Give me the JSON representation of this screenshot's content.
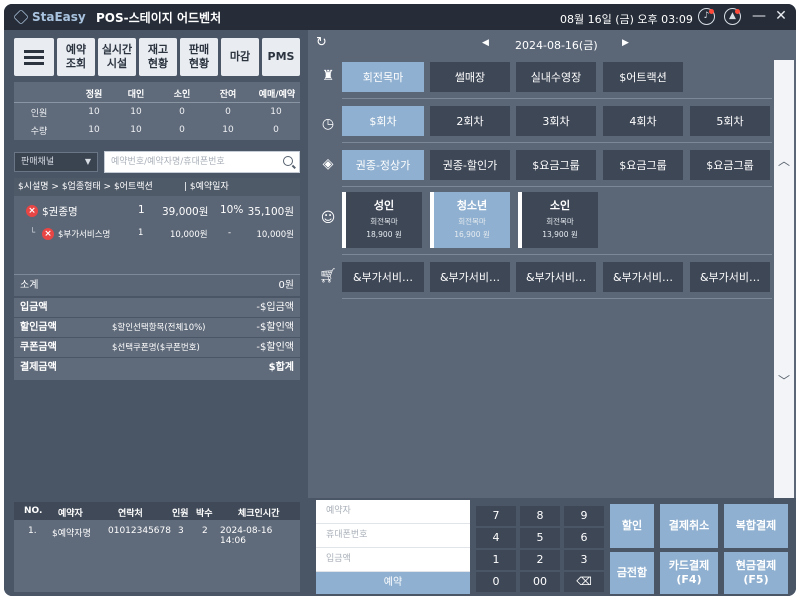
{
  "titlebar": {
    "logo": "StaEasy",
    "title": "POS-스테이지 어드벤처",
    "clock": "08월 16일 (금) 오후 03:09",
    "minimize": "—",
    "close": "✕"
  },
  "toolbar": {
    "buttons": [
      "예약\n조회",
      "실시간\n시설",
      "재고\n현황",
      "판매\n현황",
      "마감",
      "PMS"
    ]
  },
  "stock": {
    "headers": [
      "정원",
      "대인",
      "소인",
      "잔여",
      "예매/예약"
    ],
    "rows": [
      {
        "label": "인원",
        "values": [
          "10",
          "10",
          "0",
          "0",
          "10"
        ]
      },
      {
        "label": "수량",
        "values": [
          "10",
          "10",
          "0",
          "10",
          "0"
        ]
      }
    ]
  },
  "channel": {
    "label": "판매채널"
  },
  "search": {
    "placeholder": "예약번호/예약자명/휴대폰번호"
  },
  "cart": {
    "header": "$시설명 > $업종형태 > $어트랙션",
    "header_res": "| $예약일자",
    "item": {
      "name": "$권종명",
      "qty": "1",
      "price": "39,000원",
      "rate": "10%",
      "total": "35,100원"
    },
    "sub_item": {
      "name": "$부가서비스명",
      "qty": "1",
      "price": "10,000원",
      "rate": "-",
      "total": "10,000원"
    },
    "subtotal_label": "소계",
    "subtotal_value": "0원"
  },
  "summary": {
    "rows": [
      {
        "label": "입금액",
        "mid": "",
        "value": "-$입금액"
      },
      {
        "label": "할인금액",
        "mid": "$할인선택항목(전체10%)",
        "value": "-$할인액"
      },
      {
        "label": "쿠폰금액",
        "mid": "$선택쿠폰명($쿠폰번호)",
        "value": "-$할인액"
      },
      {
        "label": "결제금액",
        "mid": "",
        "value": "$합계"
      }
    ]
  },
  "reservations": {
    "headers": [
      "NO.",
      "예약자",
      "연락처",
      "인원",
      "박수",
      "체크인시간"
    ],
    "rows": [
      [
        "1.",
        "$예약자명",
        "01012345678",
        "3",
        "2",
        "2024-08-16 14:06"
      ]
    ]
  },
  "right": {
    "date": "2024-08-16(금)",
    "facilities": [
      "회전목마",
      "썰매장",
      "실내수영장",
      "$어트랙션"
    ],
    "rounds": [
      "$회차",
      "2회차",
      "3회차",
      "4회차",
      "5회차"
    ],
    "tickets": [
      "권종-정상가",
      "권종-할인가",
      "$요금그룹",
      "$요금그룹",
      "$요금그룹"
    ],
    "ages": [
      {
        "name": "성인",
        "sub": "회전목마",
        "price": "18,900 원"
      },
      {
        "name": "청소년",
        "sub": "회전목마",
        "price": "16,900 원"
      },
      {
        "name": "소인",
        "sub": "회전목마",
        "price": "13,900 원"
      }
    ],
    "addons": [
      "&부가서비…",
      "&부가서비…",
      "&부가서비…",
      "&부가서비…",
      "&부가서비…"
    ]
  },
  "bottom": {
    "inputs": {
      "name": "예약자",
      "phone": "휴대폰번호",
      "amount": "입금액"
    },
    "reserve_button": "예약",
    "keypad": [
      "7",
      "8",
      "9",
      "4",
      "5",
      "6",
      "1",
      "2",
      "3",
      "0",
      "00",
      "⌫"
    ],
    "actions": [
      "할인",
      "결제취소",
      "복합결제",
      "금전함",
      "카드결제\n(F4)",
      "현금결제\n(F5)"
    ]
  }
}
